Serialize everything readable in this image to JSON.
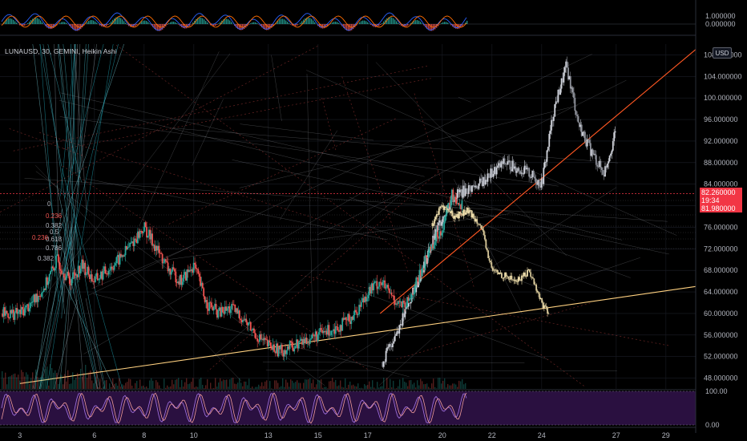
{
  "header": {
    "symbol_line": "LUNAUSD, 30, GEMINI, Heikin Ashi",
    "currency_badge": "USD"
  },
  "price_tags": {
    "last_price": "82.260000",
    "countdown": "19:34",
    "second_price": "81.980000"
  },
  "fib_labels": [
    "0",
    "0.236",
    "0.382",
    "0.5",
    "0.618",
    "0.786",
    "0.236",
    "0.382"
  ],
  "colors": {
    "background": "#000000",
    "up_candle": "#26a69a",
    "down_candle": "#ef5350",
    "ghost_candle": "#d9c99a",
    "trendline_orange": "#ff5722",
    "trendline_yellow": "#ffd180",
    "rsi_fill": "#2a1040",
    "price_tag": "#f23645"
  },
  "chart_data": [
    {
      "type": "line",
      "name": "macd-panel",
      "ylim": [
        -1,
        3
      ],
      "y_ticks": [
        "1.000000",
        "0.000000"
      ]
    },
    {
      "type": "candlestick",
      "name": "price-panel",
      "ylim": [
        46,
        110
      ],
      "y_ticks": [
        "108.000000",
        "104.000000",
        "100.000000",
        "96.000000",
        "92.000000",
        "88.000000",
        "84.000000",
        "80.000000",
        "76.000000",
        "72.000000",
        "68.000000",
        "64.000000",
        "60.000000",
        "56.000000",
        "52.000000",
        "48.000000"
      ],
      "x_ticks": [
        "3",
        "6",
        "8",
        "10",
        "13",
        "15",
        "17",
        "20",
        "22",
        "24",
        "27",
        "29"
      ],
      "x_tick_days": [
        3,
        6,
        8,
        10,
        13,
        15,
        17,
        20,
        22,
        24,
        27,
        29
      ],
      "x_range_days": [
        2.2,
        30.2
      ],
      "actual_series": {
        "x": [
          3.0,
          3.5,
          4.0,
          4.5,
          5.0,
          5.5,
          6.0,
          6.5,
          7.0,
          7.5,
          8.0,
          8.5,
          9.0,
          9.5,
          10.0,
          10.5,
          11.0,
          11.5,
          12.0,
          12.5,
          13.0,
          13.5,
          14.0,
          14.5,
          15.0,
          15.5,
          16.0,
          16.5,
          17.0,
          17.5,
          18.0,
          18.5,
          19.0,
          19.5,
          20.0,
          20.4,
          20.8
        ],
        "y": [
          60,
          62,
          65,
          70,
          66,
          69,
          66,
          68,
          70,
          73,
          76,
          72,
          68,
          66,
          69,
          62,
          60,
          61,
          59,
          56,
          54,
          53,
          54,
          55,
          56,
          57,
          58,
          60,
          64,
          66,
          63,
          61,
          66,
          72,
          76,
          82,
          80
        ]
      },
      "ghost_series": {
        "x": [
          19.5,
          20.0,
          20.5,
          21.0,
          21.5,
          22.0,
          22.5,
          23.0,
          23.5,
          24.0,
          24.3
        ],
        "y": [
          76,
          80,
          78,
          79,
          77,
          68,
          67,
          66,
          68,
          62,
          60
        ]
      },
      "ghost_up_series": {
        "x": [
          17.5,
          18.0,
          18.5,
          19.0,
          19.5,
          20.0,
          20.5,
          21.0,
          21.5,
          22.0,
          22.5,
          23.0,
          23.5,
          24.0,
          24.5,
          25.0,
          25.5,
          26.0,
          26.5,
          27.0
        ],
        "y": [
          50,
          55,
          60,
          66,
          72,
          78,
          82,
          83,
          84,
          86,
          88,
          87,
          86,
          84,
          98,
          106,
          95,
          90,
          86,
          94
        ]
      },
      "trendlines": [
        {
          "color": "orange",
          "from": [
            17.5,
            60
          ],
          "to": [
            30.2,
            109
          ]
        },
        {
          "color": "yellow",
          "from": [
            3.0,
            47
          ],
          "to": [
            30.2,
            65
          ]
        }
      ],
      "fib_levels": [
        0,
        0.236,
        0.382,
        0.5,
        0.618,
        0.786
      ],
      "last_price": 82.26
    },
    {
      "type": "line",
      "name": "rsi-panel",
      "ylim": [
        0,
        100
      ],
      "y_ticks": [
        "100.00",
        "0.00"
      ]
    }
  ]
}
